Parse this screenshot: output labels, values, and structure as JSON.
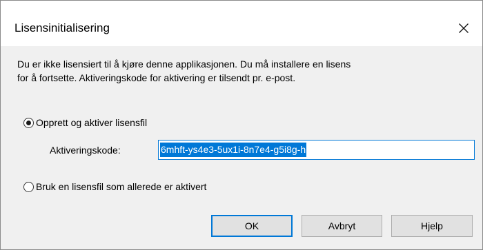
{
  "window": {
    "title": "Lisensinitialisering",
    "close_icon": "close-icon"
  },
  "message": {
    "line1": "Du er ikke lisensiert til å kjøre denne applikasjonen. Du må installere en lisens",
    "line2": "for å fortsette. Aktiveringskode for aktivering er tilsendt pr. e-post."
  },
  "options": {
    "create_label": "Opprett og aktiver lisensfil",
    "create_selected": true,
    "existing_label": "Bruk en lisensfil som allerede er aktivert",
    "existing_selected": false
  },
  "activation": {
    "label": "Aktiveringskode:",
    "value": "6mhft-ys4e3-5ux1i-8n7e4-g5i8g-h"
  },
  "buttons": {
    "ok": "OK",
    "cancel": "Avbryt",
    "help": "Hjelp"
  },
  "colors": {
    "accent": "#0078d7",
    "dialog_bg": "#f0f0f0",
    "button_bg": "#e1e1e1"
  }
}
